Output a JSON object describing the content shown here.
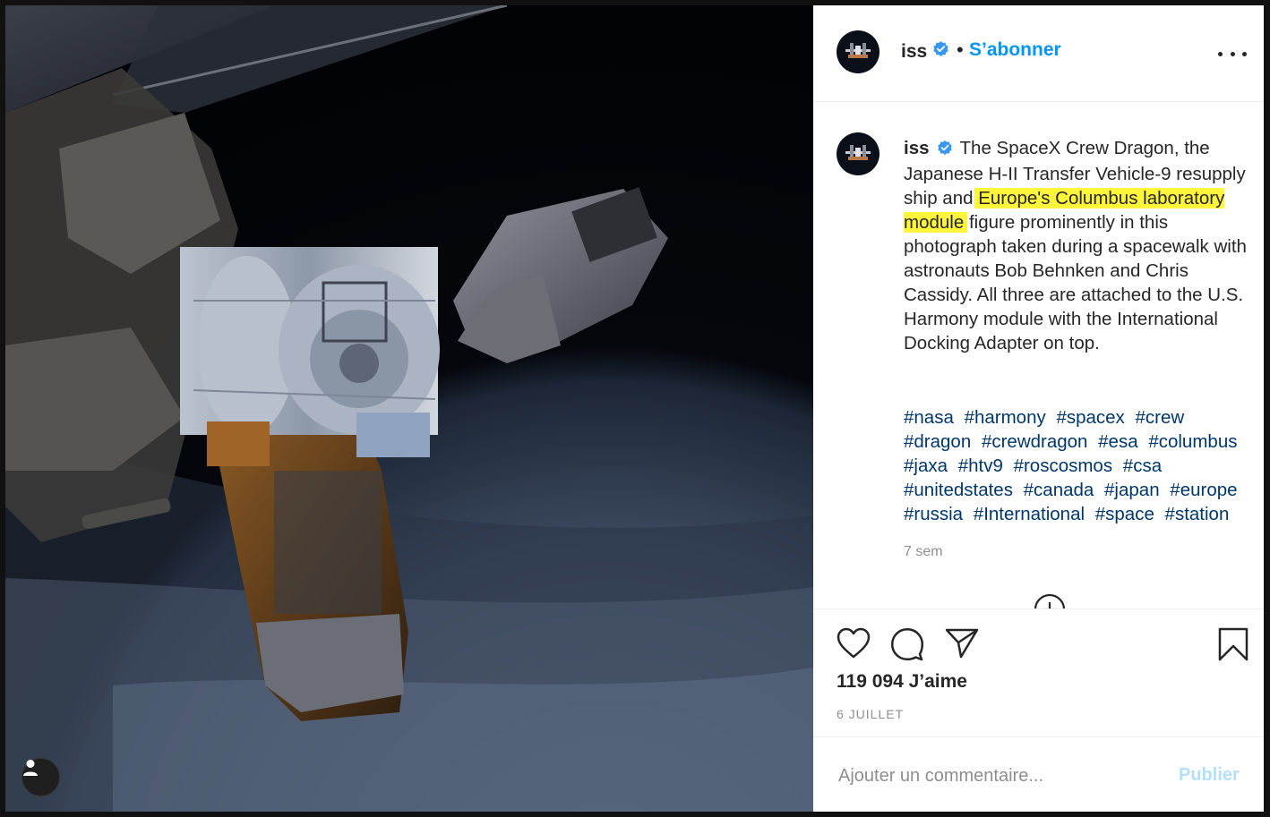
{
  "post": {
    "username": "iss",
    "separator": "•",
    "follow_label": "S’abonner",
    "caption_part1": "The SpaceX Crew Dragon, the Japanese H-II Transfer Vehicle-9 resupply ship and ",
    "caption_highlight1": "Europe's Columbus",
    "caption_highlight2": "laboratory module",
    "caption_part2": " figure prominently in this photograph taken during a spacewalk with astronauts Bob Behnken and Chris Cassidy. All three are attached to the U.S. Harmony module with the International Docking Adapter on top.",
    "hashtags": [
      "#nasa",
      "#harmony",
      "#spacex",
      "#crew",
      "#dragon",
      "#crewdragon",
      "#esa",
      "#columbus",
      "#jaxa",
      "#htv9",
      "#roscosmos",
      "#csa",
      "#unitedstates",
      "#canada",
      "#japan",
      "#europe",
      "#russia",
      "#International",
      "#space",
      "#station"
    ],
    "time_ago": "7 sem",
    "likes": "119 094 J’aime",
    "date": "6 JUILLET"
  },
  "comment": {
    "placeholder": "Ajouter un commentaire...",
    "publish_label": "Publier"
  },
  "icons": {
    "verified": "verified-badge-icon",
    "more": "more-options-icon",
    "like": "heart-icon",
    "comment": "comment-bubble-icon",
    "share": "paper-plane-icon",
    "save": "bookmark-icon",
    "load_more": "plus-circle-icon",
    "user": "user-silhouette-icon"
  },
  "colors": {
    "link": "#0095f6",
    "hashtag": "#00376b",
    "highlight": "#fff53a",
    "muted": "#8e8e8e"
  }
}
